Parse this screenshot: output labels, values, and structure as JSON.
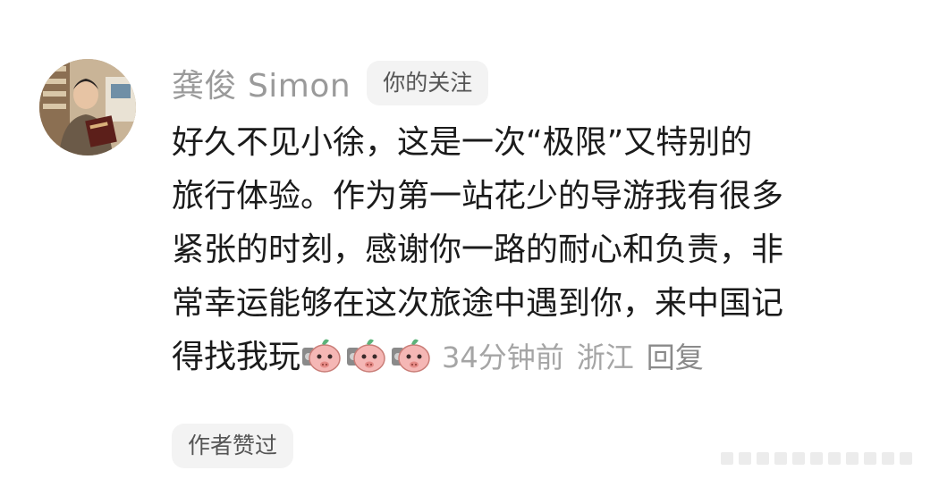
{
  "comment": {
    "author": "龚俊 Simon",
    "follow_tag": "你的关注",
    "lines": [
      "好久不见小徐，这是一次“极限”又特别的",
      "旅行体验。作为第一站花少的导游我有很多",
      "紧张的时刻，感谢你一路的耐心和负责，非",
      "常幸运能够在这次旅途中遇到你，来中国记",
      "得找我玩"
    ],
    "emojis": [
      "pig-camera-emoji",
      "pig-camera-emoji",
      "pig-camera-emoji"
    ],
    "time": "34分钟前",
    "location": "浙江",
    "reply": "回复",
    "liked_badge": "作者赞过"
  },
  "colors": {
    "username": "#9a9a9a",
    "text": "#1b1b1b",
    "meta": "#a5a5a5",
    "tag_bg": "#f3f3f3",
    "emoji_pink": "#f5b7b5"
  }
}
